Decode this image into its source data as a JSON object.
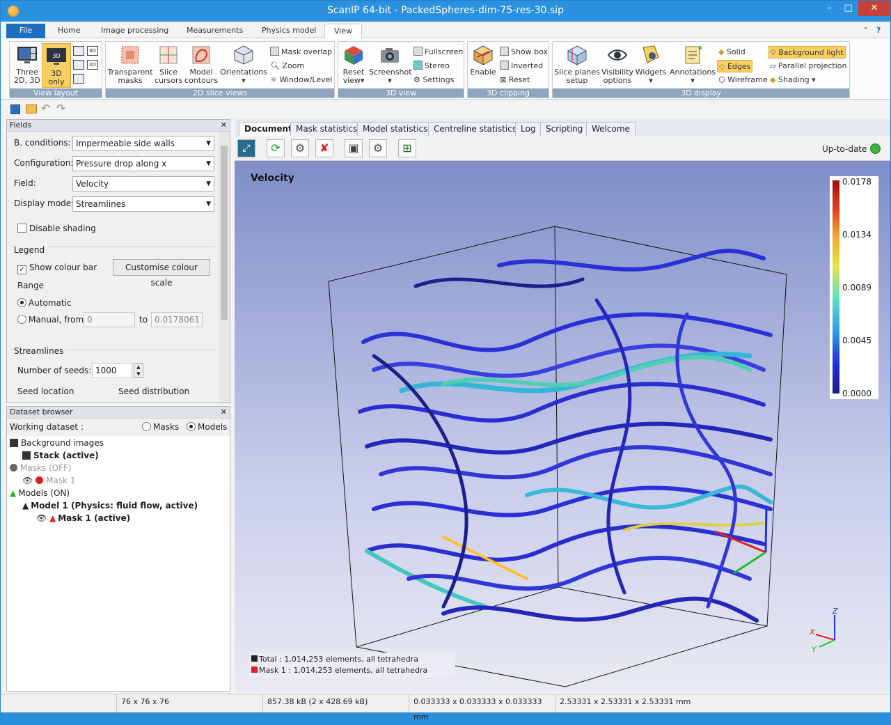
{
  "window": {
    "title": "ScanIP 64-bit - PackedSpheres-dim-75-res-30.sip",
    "minimize": "–",
    "maximize": "□",
    "close": "✕"
  },
  "ribbon_tabs": [
    {
      "label": "File"
    },
    {
      "label": "Home"
    },
    {
      "label": "Image processing"
    },
    {
      "label": "Measurements"
    },
    {
      "label": "Physics model"
    },
    {
      "label": "View"
    }
  ],
  "ribbon_help": "?",
  "groups": {
    "view_layout": {
      "label": "View layout",
      "three": "Three\n2D, 3D",
      "three_l1": "Three",
      "three_l2": "2D, 3D",
      "only_l1": "3D",
      "only_l2": "only",
      "icon_3d": "3D",
      "icon_2d": "2D"
    },
    "slice_views": {
      "label": "2D slice views",
      "transparent_l1": "Transparent",
      "transparent_l2": "masks",
      "slice_l1": "Slice",
      "slice_l2": "cursors",
      "model_l1": "Model",
      "model_l2": "contours",
      "orientations": "Orientations",
      "mask_overlap": "Mask overlap",
      "zoom": "Zoom",
      "window_level": "Window/Level"
    },
    "view3d": {
      "label": "3D view",
      "reset_l1": "Reset",
      "reset_l2": "view",
      "screenshot": "Screenshot",
      "fullscreen": "Fullscreen",
      "stereo": "Stereo",
      "settings": "Settings"
    },
    "clipping": {
      "label": "3D clipping",
      "enable": "Enable",
      "show_box": "Show box",
      "inverted": "Inverted",
      "reset": "Reset"
    },
    "display": {
      "label": "3D display",
      "slice_planes_l1": "Slice planes",
      "slice_planes_l2": "setup",
      "visibility_l1": "Visibility",
      "visibility_l2": "options",
      "widgets": "Widgets",
      "annotations": "Annotations",
      "solid": "Solid",
      "edges": "Edges",
      "wireframe": "Wireframe",
      "background_light": "Background light",
      "parallel": "Parallel projection",
      "shading": "Shading"
    }
  },
  "fields_panel": {
    "title": "Fields",
    "close": "✕",
    "b_conditions_label": "B. conditions:",
    "b_conditions_value": "Impermeable side walls",
    "configuration_label": "Configuration:",
    "configuration_value": "Pressure drop along x",
    "field_label": "Field:",
    "field_value": "Velocity",
    "display_mode_label": "Display mode:",
    "display_mode_value": "Streamlines",
    "disable_shading": "Disable shading",
    "legend": "Legend",
    "show_colour_bar": "Show colour bar",
    "customise": "Customise colour scale",
    "range": "Range",
    "automatic": "Automatic",
    "manual_from": "Manual, from",
    "manual_min": "0",
    "to": "to",
    "manual_max": "0.0178061",
    "streamlines": "Streamlines",
    "seeds_label": "Number of seeds:",
    "seeds_value": "1000",
    "seed_location": "Seed location",
    "seed_distribution": "Seed distribution"
  },
  "dataset_panel": {
    "title": "Dataset browser",
    "close": "✕",
    "working_dataset": "Working dataset :",
    "masks": "Masks",
    "models": "Models",
    "tree": [
      {
        "label": "Background images"
      },
      {
        "label": "Stack (active)"
      },
      {
        "label": "Masks (OFF)"
      },
      {
        "label": "Mask 1"
      },
      {
        "label": "Models (ON)"
      },
      {
        "label": "Model 1 (Physics: fluid flow, active)"
      },
      {
        "label": "Mask 1 (active)"
      }
    ]
  },
  "doc_tabs": [
    {
      "label": "Document"
    },
    {
      "label": "Mask statistics"
    },
    {
      "label": "Model statistics"
    },
    {
      "label": "Centreline statistics"
    },
    {
      "label": "Log"
    },
    {
      "label": "Scripting"
    },
    {
      "label": "Welcome"
    }
  ],
  "viewer": {
    "status": "Up-to-date",
    "field_title": "Velocity",
    "colorbar_ticks": [
      "0.0178",
      "0.0134",
      "0.0089",
      "0.0045",
      "0.0000"
    ],
    "axis_z": "Z",
    "axis_x": "X",
    "axis_y": "Y",
    "info_total": "Total : 1,014,253 elements, all tetrahedra",
    "info_mask": "Mask 1 : 1,014,253 elements, all tetrahedra",
    "colors": {
      "total": "#222222",
      "mask": "#e02020",
      "status_led": "#3bb43b"
    }
  },
  "statusbar": {
    "dims": "76 x 76 x 76",
    "size": "857.38 kB (2 x 428.69 kB)",
    "spacing": "0.033333 x 0.033333 x 0.033333 mm",
    "extent": "2.53331 x 2.53331 x 2.53331 mm"
  }
}
